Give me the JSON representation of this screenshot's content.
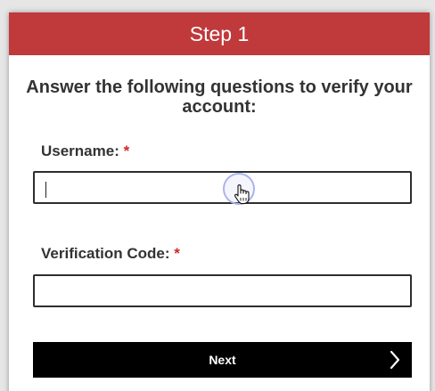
{
  "header": {
    "title": "Step 1"
  },
  "form": {
    "prompt": "Answer the following questions to verify your account:",
    "username": {
      "label": "Username:",
      "required_marker": "*",
      "value": ""
    },
    "verification": {
      "label": "Verification Code:",
      "required_marker": "*",
      "value": ""
    },
    "next_label": "Next"
  },
  "icons": {
    "next": "chevron-right-icon",
    "pointer": "hand-pointer-icon"
  },
  "colors": {
    "header_bg": "#c0393b",
    "required": "#cc2a2a",
    "button_bg": "#000000",
    "text": "#333333"
  }
}
